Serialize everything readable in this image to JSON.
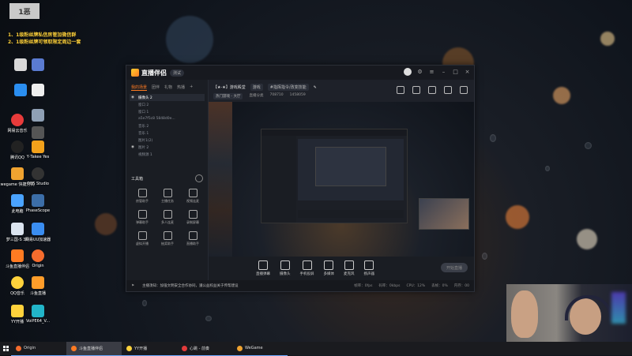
{
  "desktop": {
    "banner_logo_text": "1恶",
    "banner_lines": [
      "1、1级粉丝牌私信房管加微信群",
      "2、1级粉丝牌可领取限定周边一套"
    ],
    "icons": [
      {
        "label": "",
        "icon": "app-icon"
      },
      {
        "label": "",
        "icon": "app-icon"
      },
      {
        "label": "",
        "icon": "app-icon"
      },
      {
        "label": "",
        "icon": "app-icon"
      },
      {
        "label": "",
        "icon": "app-icon"
      },
      {
        "label": "网易云音乐",
        "icon": "music-icon"
      },
      {
        "label": "",
        "icon": "app-icon"
      },
      {
        "label": "腾讯QQ",
        "icon": "qq-icon"
      },
      {
        "label": "Y·Takee Yes",
        "icon": "app-icon"
      },
      {
        "label": "wegame 快捷方式",
        "icon": "wegame-icon"
      },
      {
        "label": "OBS Studio",
        "icon": "obs-icon"
      },
      {
        "label": "此电脑",
        "icon": "computer-icon"
      },
      {
        "label": "PhaseScope",
        "icon": "app-icon"
      },
      {
        "label": "梦三国-S 3D",
        "icon": "game-icon"
      },
      {
        "label": "网易UU加速器",
        "icon": "app-icon"
      },
      {
        "label": "斗鱼直播伴侣",
        "icon": "douyu-icon"
      },
      {
        "label": "Origin",
        "icon": "origin-icon"
      },
      {
        "label": "QQ音乐",
        "icon": "music-icon"
      },
      {
        "label": "斗鱼直播",
        "icon": "douyu-icon"
      },
      {
        "label": "YY开播",
        "icon": "yy-icon"
      },
      {
        "label": "VoiPE64_V...",
        "icon": "app-icon"
      }
    ]
  },
  "app": {
    "name": "直播伴侣",
    "version_badge": "测试",
    "tabs": [
      "我的场景",
      "团伴",
      "礼物",
      "热播"
    ],
    "active_tab": "我的场景",
    "scenes": [
      {
        "label": "摄像头 2",
        "visible": true,
        "highlight": true
      },
      {
        "label": "窗口 2",
        "visible": false,
        "highlight": false
      },
      {
        "label": "窗口 1",
        "visible": false,
        "highlight": false
      },
      {
        "label": "a5e7f5c8 5848d0e...",
        "visible": false,
        "highlight": false
      },
      {
        "label": "音乐 2",
        "visible": false,
        "highlight": false
      },
      {
        "label": "音乐 1",
        "visible": false,
        "highlight": false
      },
      {
        "label": "图片1(2)",
        "visible": false,
        "highlight": false
      },
      {
        "label": "图片 2",
        "visible": true,
        "highlight": false
      },
      {
        "label": "视频源 1",
        "visible": false,
        "highlight": false
      }
    ],
    "tools_title": "工具箱",
    "tools": [
      {
        "label": "房管助手",
        "icon": "bell-icon"
      },
      {
        "label": "主播任务",
        "icon": "task-icon"
      },
      {
        "label": "视频连麦",
        "icon": "video-call-icon"
      },
      {
        "label": "弹幕助手",
        "icon": "danmaku-icon"
      },
      {
        "label": "多人连麦",
        "icon": "group-icon"
      },
      {
        "label": "录制屏幕",
        "icon": "record-icon"
      },
      {
        "label": "虚拟开播",
        "icon": "virtual-icon"
      },
      {
        "label": "抽奖助手",
        "icon": "lottery-icon"
      },
      {
        "label": "直播助手",
        "icon": "assistant-icon"
      }
    ],
    "stream_title": "【★-★】游戏殿堂",
    "stream_tags": [
      "游戏",
      "#指挥指令/改变技能"
    ],
    "sub_info": [
      "热门游戏 - 大厅",
      "直播分类",
      "708710",
      "1458059"
    ],
    "bottom_buttons": [
      "直播弹幕",
      "摄像头",
      "手机投屏",
      "多媒体",
      "麦克风",
      "扬声器"
    ],
    "go_live": "开始直播",
    "status_notice": "主播须知：加强文明安全合作协同，遵公益权益关于传帮建设",
    "status_stats": [
      "帧率：0fps",
      "码率：0kbps",
      "CPU：12%",
      "丢帧：0%",
      "内存：00"
    ]
  },
  "taskbar": {
    "items": [
      {
        "label": "Origin",
        "color": "#f56c2d",
        "active": false
      },
      {
        "label": "斗鱼直播伴侣",
        "color": "#ff7b22",
        "active": true
      },
      {
        "label": "YY开播",
        "color": "#ffd23c",
        "active": false
      },
      {
        "label": "心跳 - 前奏",
        "color": "#e33b3b",
        "active": false
      },
      {
        "label": "WeGame",
        "color": "#f0a330",
        "active": false
      }
    ]
  },
  "colors": {
    "accent": "#ff7b22",
    "banner_text": "#ffd23c",
    "app_bg": "#1c1f26"
  }
}
